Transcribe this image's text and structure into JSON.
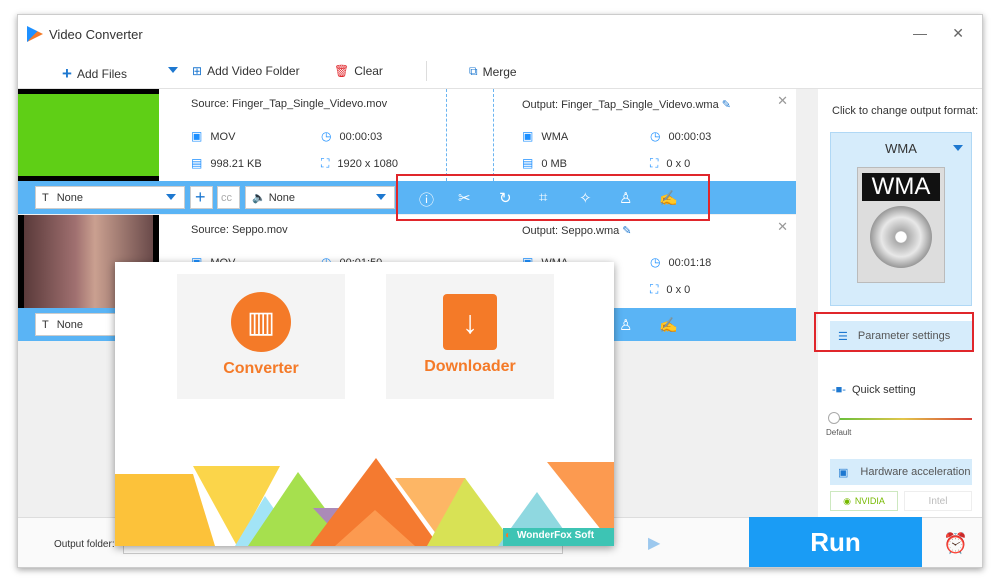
{
  "window": {
    "title": "Video Converter",
    "minimize": "—",
    "close": "✕"
  },
  "toolbar": {
    "add_files": "Add Files",
    "add_folder": "Add Video Folder",
    "clear": "Clear",
    "merge": "Merge"
  },
  "items": [
    {
      "source": "Source: Finger_Tap_Single_Videvo.mov",
      "src_format": "MOV",
      "src_duration": "00:00:03",
      "src_size": "998.21 KB",
      "src_resolution": "1920 x 1080",
      "output": "Output: Finger_Tap_Single_Videvo.wma",
      "out_format": "WMA",
      "out_duration": "00:00:03",
      "out_size": "0 MB",
      "out_resolution": "0 x 0",
      "subtitle": "None",
      "audio": "None"
    },
    {
      "source": "Source: Seppo.mov",
      "src_format": "MOV",
      "src_duration": "00:01:50",
      "output": "Output: Seppo.wma",
      "out_format": "WMA",
      "out_duration": "00:01:18",
      "out_resolution": "0 x 0",
      "subtitle": "None"
    }
  ],
  "side": {
    "hint": "Click to change output format:",
    "format": "WMA",
    "format_icon_text": "WMA",
    "param": "Parameter settings",
    "quick": "Quick setting",
    "slider_label": "Default",
    "slider_level": 0,
    "hw": "Hardware acceleration",
    "nvidia": "NVIDIA",
    "intel": "Intel"
  },
  "bottom": {
    "output_folder": "Output folder:",
    "run": "Run"
  },
  "popup": {
    "converter": "Converter",
    "downloader": "Downloader",
    "brand": "WonderFox Soft"
  },
  "colors": {
    "accent": "#1a9cf5",
    "bar": "#5ab4f5",
    "orange": "#f47a28",
    "highlight": "#e0262b"
  }
}
